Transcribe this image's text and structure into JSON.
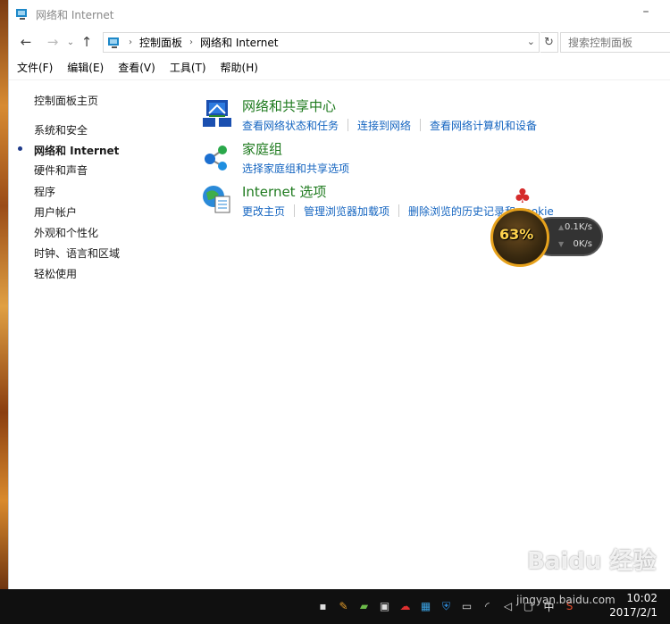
{
  "window": {
    "title": "网络和 Internet"
  },
  "nav": {
    "breadcrumb": [
      "控制面板",
      "网络和 Internet"
    ],
    "search_placeholder": "搜索控制面板"
  },
  "menubar": {
    "items": [
      "文件(F)",
      "编辑(E)",
      "查看(V)",
      "工具(T)",
      "帮助(H)"
    ]
  },
  "sidebar": {
    "home": "控制面板主页",
    "categories": [
      "系统和安全",
      "网络和 Internet",
      "硬件和声音",
      "程序",
      "用户帐户",
      "外观和个性化",
      "时钟、语言和区域",
      "轻松使用"
    ],
    "active": "网络和 Internet"
  },
  "sections": [
    {
      "title": "网络和共享中心",
      "icon": "network-sharing-icon",
      "links": [
        "查看网络状态和任务",
        "连接到网络",
        "查看网络计算机和设备"
      ]
    },
    {
      "title": "家庭组",
      "icon": "homegroup-icon",
      "links": [
        "选择家庭组和共享选项"
      ]
    },
    {
      "title": "Internet 选项",
      "icon": "internet-options-icon",
      "links": [
        "更改主页",
        "管理浏览器加载项",
        "删除浏览的历史记录和 cookie"
      ]
    }
  ],
  "speed_widget": {
    "percent": "63%",
    "up": "0.1K/s",
    "down": "0K/s"
  },
  "taskbar": {
    "time": "10:02",
    "date": "2017/2/1",
    "tray_icons": [
      "network-tray-icon",
      "pen-tray-icon",
      "driver-tray-icon",
      "printer-tray-icon",
      "cloud-tray-icon",
      "security-tray-icon",
      "shield-tray-icon",
      "monitor-tray-icon",
      "wifi-tray-icon",
      "volume-tray-icon",
      "message-tray-icon",
      "ime-tray-icon",
      "sogou-tray-icon"
    ],
    "ime_label": "中"
  },
  "watermark": {
    "text": "Baidu 经验",
    "sub": "jingyan.baidu.com"
  },
  "colors": {
    "link": "#1565c0",
    "section_title": "#1e7a1e",
    "taskbar": "#101010"
  }
}
